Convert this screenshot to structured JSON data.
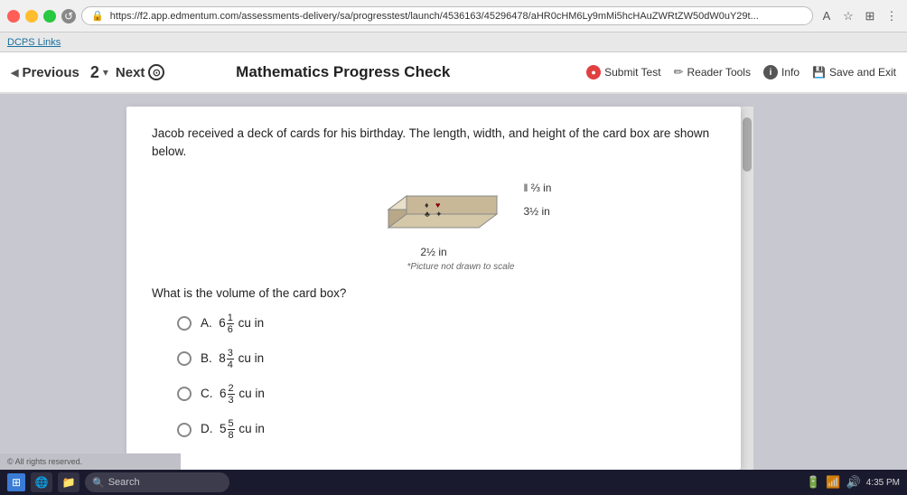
{
  "browser": {
    "url": "https://f2.app.edmentum.com/assessments-delivery/sa/progresstest/launch/4536163/45296478/aHR0cHM6Ly9mMi5hcHAuZWRtZW50dW0uY29t...",
    "reload_icon": "↺"
  },
  "links_bar": {
    "label": "DCPS Links"
  },
  "nav": {
    "prev_label": "Previous",
    "number": "2",
    "next_label": "Next",
    "title": "Mathematics Progress Check",
    "submit_label": "Submit Test",
    "reader_label": "Reader Tools",
    "info_label": "Info",
    "save_label": "Save and Exit"
  },
  "question": {
    "intro": "Jacob received a deck of cards for his birthday. The length, width, and height of the card box are shown below.",
    "dim_height": "⅔ in",
    "dim_width": "3½ in",
    "dim_length": "2½ in",
    "caption": "*Picture not drawn to scale",
    "prompt": "What is the volume of the card box?",
    "options": [
      {
        "letter": "A.",
        "whole": "6",
        "num": "1",
        "den": "6",
        "unit": "cu in"
      },
      {
        "letter": "B.",
        "whole": "8",
        "num": "3",
        "den": "4",
        "unit": "cu in"
      },
      {
        "letter": "C.",
        "whole": "6",
        "num": "2",
        "den": "3",
        "unit": "cu in"
      },
      {
        "letter": "D.",
        "whole": "5",
        "num": "5",
        "den": "8",
        "unit": "cu in"
      }
    ]
  },
  "taskbar": {
    "search_placeholder": "Search",
    "time": "4:35 PM"
  },
  "copyright": "© All rights reserved."
}
